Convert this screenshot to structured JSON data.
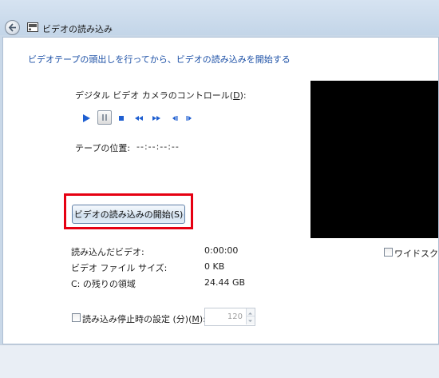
{
  "window": {
    "title": "ビデオの読み込み"
  },
  "main": {
    "heading": "ビデオテープの頭出しを行ってから、ビデオの読み込みを開始する",
    "camera_control": {
      "label_before": "デジタル ビデオ カメラのコントロール(",
      "label_key": "D",
      "label_after": "):",
      "buttons": [
        {
          "name": "play",
          "icon": "play-icon"
        },
        {
          "name": "pause",
          "icon": "pause-icon"
        },
        {
          "name": "stop",
          "icon": "stop-icon"
        },
        {
          "name": "rewind",
          "icon": "rewind-icon"
        },
        {
          "name": "fast-forward",
          "icon": "fast-forward-icon"
        },
        {
          "name": "previous-frame",
          "icon": "previous-frame-icon"
        },
        {
          "name": "next-frame",
          "icon": "next-frame-icon"
        }
      ]
    },
    "tape_position": {
      "label": "テープの位置:",
      "value": "--:--:--:--"
    },
    "import_button": {
      "label": "ビデオの読み込みの開始(S)"
    },
    "info": {
      "imported_video": {
        "label": "読み込んだビデオ:",
        "value": "0:00:00"
      },
      "file_size": {
        "label": "ビデオ ファイル サイズ:",
        "value": "0 KB"
      },
      "free_space": {
        "label": "C: の残りの領域",
        "value": "24.44 GB"
      }
    },
    "stop_setting": {
      "label_before": "読み込み停止時の設定 (分)(",
      "label_key": "M",
      "label_after": "):",
      "checked": false,
      "value": "120"
    },
    "widescreen": {
      "label": "ワイドスクリ",
      "checked": false
    }
  },
  "colors": {
    "heading": "#1c50a6",
    "transport_icons": "#1f5fd1",
    "highlight": "#e60012",
    "preview": "#000000"
  }
}
